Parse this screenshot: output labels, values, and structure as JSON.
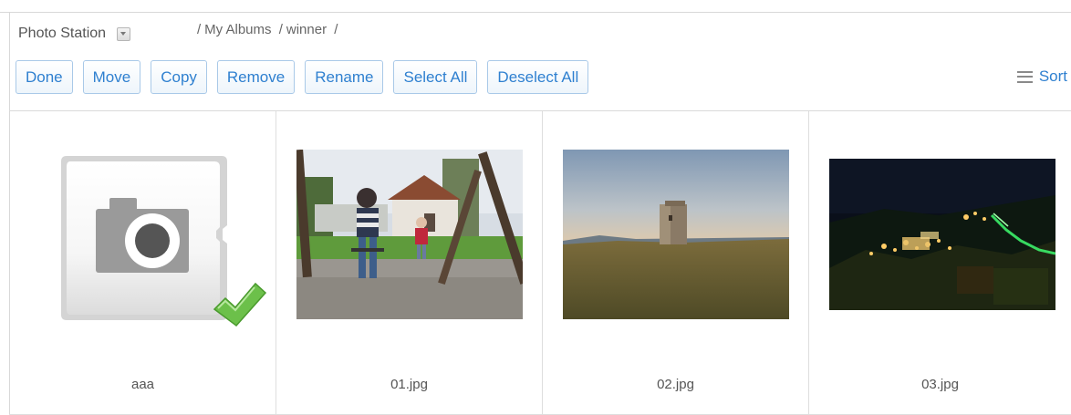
{
  "header": {
    "app_title": "Photo Station",
    "breadcrumb": [
      "/",
      "My Albums",
      "/",
      "winner",
      "/"
    ]
  },
  "toolbar": {
    "buttons": [
      "Done",
      "Move",
      "Copy",
      "Remove",
      "Rename",
      "Select All",
      "Deselect All"
    ],
    "sort_label": "Sort"
  },
  "items": [
    {
      "caption": "aaa",
      "thumbnail": "camera-placeholder-icon",
      "selected": true
    },
    {
      "caption": "01.jpg",
      "thumbnail": "photo-playground-swing",
      "selected": false
    },
    {
      "caption": "02.jpg",
      "thumbnail": "photo-tower-sunset",
      "selected": false
    },
    {
      "caption": "03.jpg",
      "thumbnail": "photo-village-night",
      "selected": false
    }
  ],
  "colors": {
    "accent": "#2f80d0",
    "button_border": "#a9c9e8",
    "check": "#6cc04a"
  }
}
